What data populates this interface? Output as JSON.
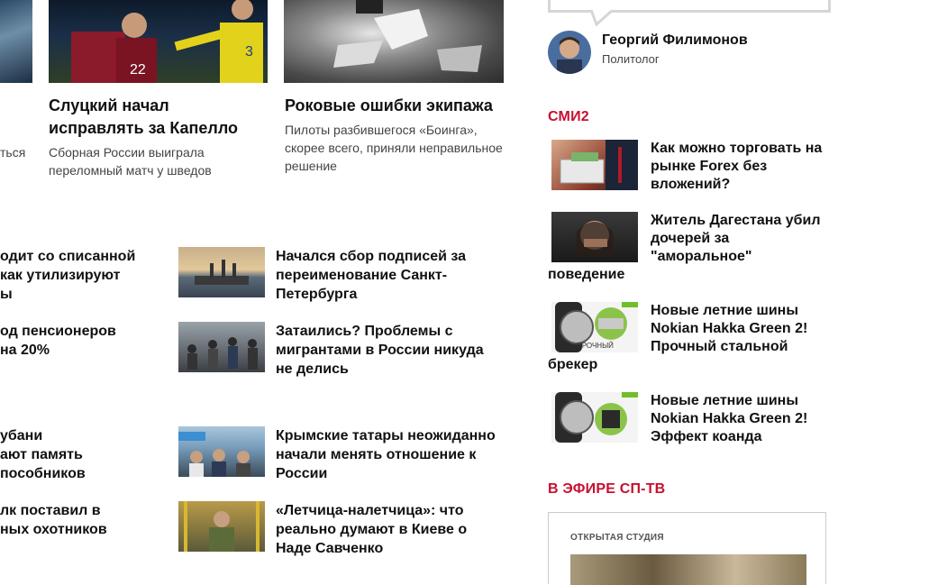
{
  "top_cards": [
    {
      "title": "Слуцкий начал исправлять за Капелло",
      "lead": "Сборная России выиграла переломный матч у шведов"
    },
    {
      "title": "Роковые ошибки экипажа",
      "lead": "Пилоты разбившегося «Боинга», скорее всего, приняли неправильное решение"
    }
  ],
  "left_partial": {
    "lead_fragment": "ться"
  },
  "left_column_fragments": [
    [
      "одит со списанной",
      "как утилизируют",
      "ы"
    ],
    [
      "од пенсионеров",
      "на 20%"
    ],
    [
      "убани",
      "ают память",
      "пособников"
    ],
    [
      "лк поставил в",
      "ных охотников"
    ]
  ],
  "news": [
    {
      "title": "Начался сбор подписей за переименование Санкт-Петербурга"
    },
    {
      "title": "Затаились? Проблемы с мигрантами в России никуда не делись"
    },
    {
      "title": "Крымские татары неожиданно начали менять отношение к России"
    },
    {
      "title": "«Летчица-налетчица»: что реально думают в Киеве о Наде Савченко"
    }
  ],
  "expert": {
    "name": "Георгий Филимонов",
    "role": "Политолог"
  },
  "smi2": {
    "heading": "СМИ2",
    "items": [
      {
        "title": "Как можно торговать на рынке Forex без вложений?"
      },
      {
        "title": "Житель Дагестана убил дочерей за \"аморальное\" поведение"
      },
      {
        "title": "Новые летние шины Nokian Hakka Green 2! Прочный стальной брекер",
        "thumb_caption": "ПРОЧНЫЙ"
      },
      {
        "title": "Новые летние шины Nokian Hakka Green 2! Эффект коанда"
      }
    ]
  },
  "sptv": {
    "heading": "В ЭФИРЕ СП-ТВ",
    "label": "ОТКРЫТАЯ СТУДИЯ"
  },
  "colors": {
    "accent": "#c8102e",
    "text": "#111111",
    "muted": "#444444",
    "border": "#cccccc"
  }
}
